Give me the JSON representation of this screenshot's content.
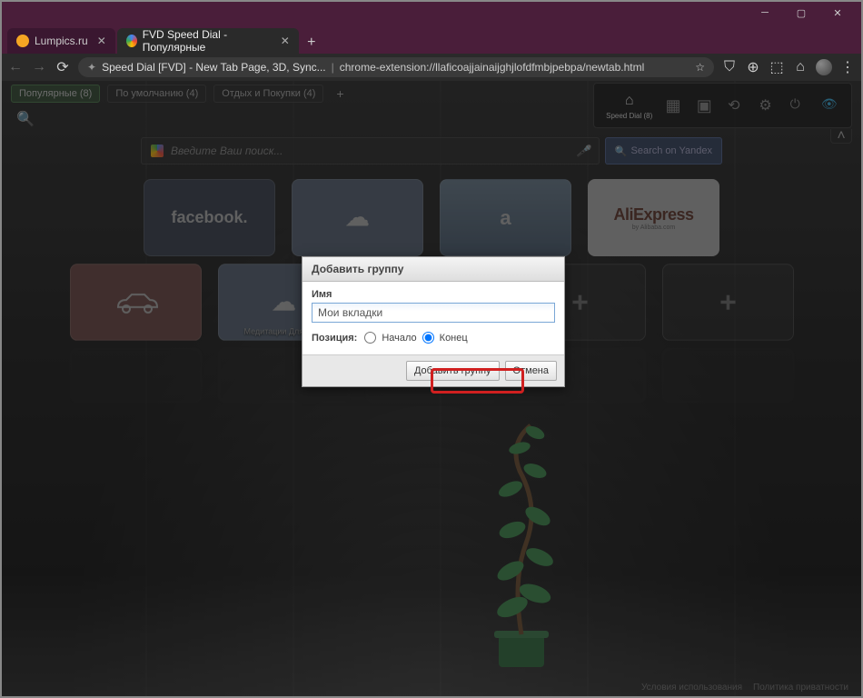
{
  "window": {
    "tabs": [
      {
        "title": "Lumpics.ru",
        "favicon_color": "#f5a623"
      },
      {
        "title": "FVD Speed Dial - Популярные",
        "favicon_color": "#4285f4"
      }
    ],
    "active_tab_index": 1
  },
  "address_bar": {
    "page_title_segment": "Speed Dial [FVD] - New Tab Page, 3D, Sync...",
    "url_segment": "chrome-extension://llaficoajjainaijghjlofdfmbjpebpa/newtab.html"
  },
  "groups": [
    {
      "label": "Популярные (8)",
      "selected": true
    },
    {
      "label": "По умолчанию (4)",
      "selected": false
    },
    {
      "label": "Отдых и Покупки (4)",
      "selected": false
    }
  ],
  "toolbar": {
    "speed_dial_label": "Speed Dial (8)"
  },
  "search": {
    "placeholder": "Введите Ваш поиск...",
    "button_label": "Search on Yandex"
  },
  "dials": {
    "row1": [
      {
        "kind": "fb",
        "text": "facebook."
      },
      {
        "kind": "med",
        "text": "",
        "label": ""
      },
      {
        "kind": "amz",
        "text": "",
        "label": ""
      },
      {
        "kind": "ae",
        "text": "AliExpress",
        "sub": "by Alibaba.com"
      }
    ],
    "row2": [
      {
        "kind": "car",
        "text": ""
      },
      {
        "kind": "med2",
        "text": "",
        "label": "Медитации Для Всех"
      },
      {
        "kind": "book",
        "text": ""
      },
      {
        "kind": "plus",
        "text": "+"
      },
      {
        "kind": "plus",
        "text": "+"
      }
    ]
  },
  "dialog": {
    "title": "Добавить группу",
    "name_label": "Имя",
    "name_value": "Мои вкладки",
    "position_label": "Позиция:",
    "opt_start": "Начало",
    "opt_end": "Конец",
    "submit_label": "Добавить группу",
    "cancel_label": "Отмена"
  },
  "footer": {
    "terms": "Условия использования",
    "privacy": "Политика приватности"
  }
}
